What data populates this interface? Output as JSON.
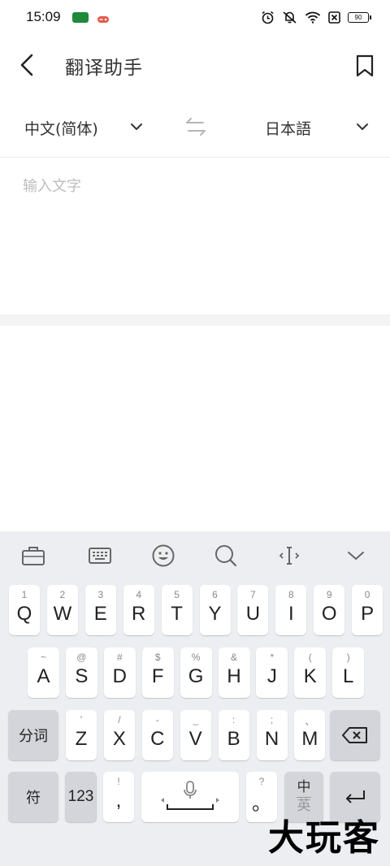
{
  "status_bar": {
    "time": "15:09",
    "battery": "90",
    "icons": [
      "alarm-icon",
      "mute-icon",
      "wifi-icon",
      "sim-off-icon",
      "battery-icon"
    ]
  },
  "header": {
    "title": "翻译助手",
    "back_icon": "chevron-left-icon",
    "bookmark_icon": "bookmark-icon"
  },
  "language": {
    "source": "中文(简体)",
    "target": "日本語",
    "swap_icon": "swap-arrows-icon"
  },
  "input": {
    "value": "",
    "placeholder": "输入文字"
  },
  "keyboard": {
    "toolbar": [
      "briefcase-icon",
      "keyboard-icon",
      "emoji-icon",
      "search-icon",
      "cursor-icon",
      "chevron-down-icon"
    ],
    "row1": [
      {
        "main": "Q",
        "hint": "1"
      },
      {
        "main": "W",
        "hint": "2"
      },
      {
        "main": "E",
        "hint": "3"
      },
      {
        "main": "R",
        "hint": "4"
      },
      {
        "main": "T",
        "hint": "5"
      },
      {
        "main": "Y",
        "hint": "6"
      },
      {
        "main": "U",
        "hint": "7"
      },
      {
        "main": "I",
        "hint": "8"
      },
      {
        "main": "O",
        "hint": "9"
      },
      {
        "main": "P",
        "hint": "0"
      }
    ],
    "row2": [
      {
        "main": "A",
        "hint": "~"
      },
      {
        "main": "S",
        "hint": "@"
      },
      {
        "main": "D",
        "hint": "#"
      },
      {
        "main": "F",
        "hint": "$"
      },
      {
        "main": "G",
        "hint": "%"
      },
      {
        "main": "H",
        "hint": "&"
      },
      {
        "main": "J",
        "hint": "*"
      },
      {
        "main": "K",
        "hint": "("
      },
      {
        "main": "L",
        "hint": ")"
      }
    ],
    "row3": [
      {
        "main": "Z",
        "hint": "'"
      },
      {
        "main": "X",
        "hint": "/"
      },
      {
        "main": "C",
        "hint": "-"
      },
      {
        "main": "V",
        "hint": "_"
      },
      {
        "main": "B",
        "hint": ":"
      },
      {
        "main": "N",
        "hint": ";"
      },
      {
        "main": "M",
        "hint": "、"
      }
    ],
    "fenci": "分词",
    "fu": "符",
    "num": "123",
    "comma": {
      "main": ",",
      "hint": "!"
    },
    "period": {
      "main": "。",
      "hint": "?"
    },
    "zh_toggle": {
      "zh": "中",
      "en": "英"
    },
    "backspace_icon": "backspace-icon",
    "enter_icon": "enter-icon",
    "mic_icon": "microphone-icon"
  },
  "watermark": "大玩客"
}
